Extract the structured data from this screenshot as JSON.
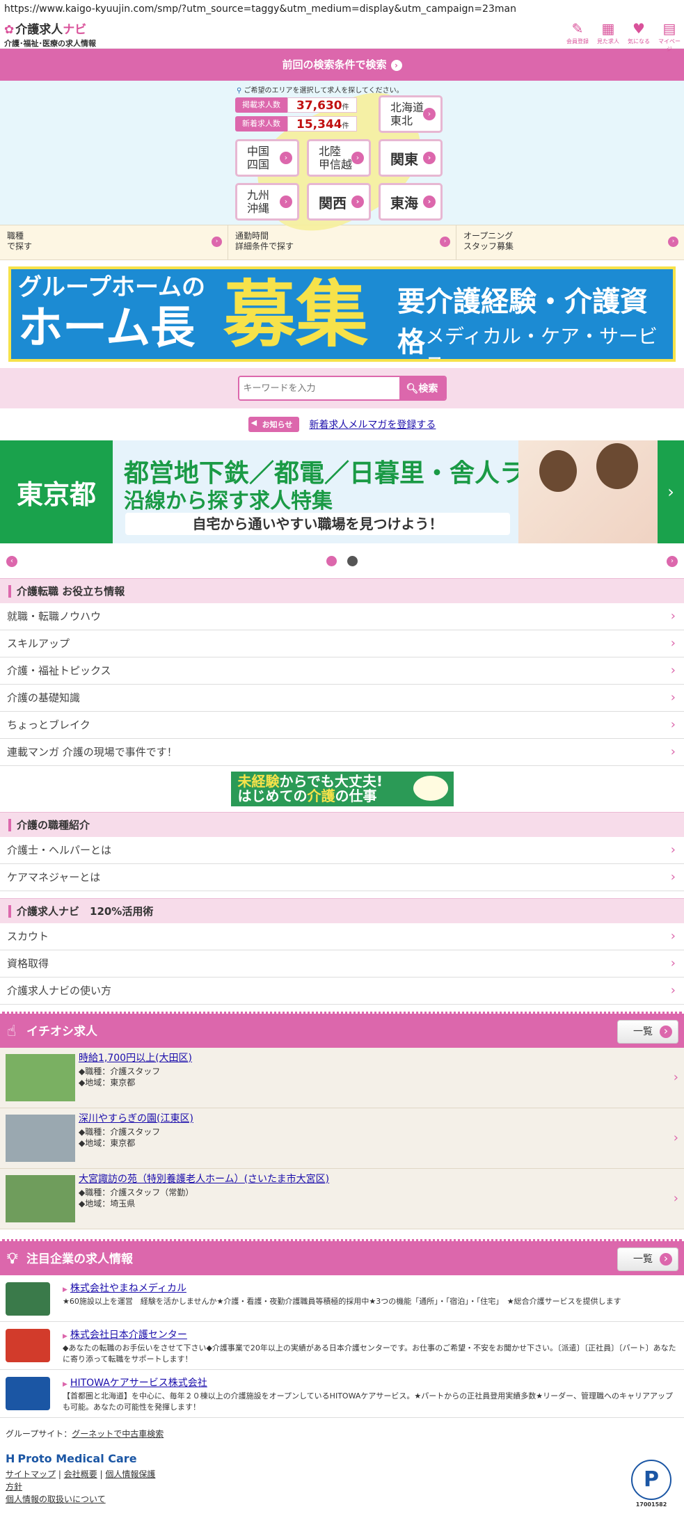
{
  "url": "https://www.kaigo-kyuujin.com/smp/?utm_source=taggy&utm_medium=display&utm_campaign=23man",
  "header": {
    "logo_part1": "介護求人",
    "logo_part2": "ナビ",
    "tagline": "介護･福祉･医療の求人情報",
    "icons": [
      {
        "label": "会員登録",
        "icon": "pencil-icon"
      },
      {
        "label": "見た求人",
        "icon": "calendar-icon"
      },
      {
        "label": "気になる",
        "icon": "heart-icon"
      },
      {
        "label": "マイページ",
        "icon": "book-icon"
      }
    ]
  },
  "prev_search_label": "前回の検索条件で検索",
  "map": {
    "hint": "ご希望のエリアを選択して求人を探してください。",
    "published_label": "掲載求人数",
    "published_count": "37,630",
    "new_label": "新着求人数",
    "new_count": "15,344",
    "unit": "件",
    "regions": [
      "北海道\n東北",
      "中国\n四国",
      "北陸\n甲信越",
      "関東",
      "九州\n沖縄",
      "関西",
      "東海"
    ]
  },
  "categories": [
    {
      "line1": "職種",
      "line2": "で探す"
    },
    {
      "line1": "通勤時間",
      "line2": "詳細条件で探す"
    },
    {
      "line1": "オープニング",
      "line2": "スタッフ募集"
    }
  ],
  "banner1": {
    "line1": "グループホームの",
    "line2": "ホーム長",
    "big": "募集",
    "req": "要介護経験・介護資格",
    "company": "メディカル・ケア・サービス"
  },
  "search": {
    "placeholder": "キーワードを入力",
    "button": "検索"
  },
  "notice": {
    "tag": "お知らせ",
    "link": "新着求人メルマガを登録する"
  },
  "banner2": {
    "pref": "東京都",
    "line1": "都営地下鉄／都電／日暮里・舎人ライナー",
    "line2": "沿線から探す求人特集",
    "line3": "自宅から通いやすい職場を見つけよう！"
  },
  "sections": {
    "tips_title": "介護転職 お役立ち情報",
    "tips": [
      "就職・転職ノウハウ",
      "スキルアップ",
      "介護・福祉トピックス",
      "介護の基礎知識",
      "ちょっとブレイク",
      "連載マンガ 介護の現場で事件です！"
    ],
    "mid_banner_l1a": "未経験",
    "mid_banner_l1b": "からでも大丈夫!",
    "mid_banner_l2a": "はじめての",
    "mid_banner_l2b": "介護",
    "mid_banner_l2c": "の仕事",
    "jobs_title": "介護の職種紹介",
    "jobs": [
      "介護士・ヘルパーとは",
      "ケアマネジャーとは"
    ],
    "use_title": "介護求人ナビ　120%活用術",
    "use": [
      "スカウト",
      "資格取得",
      "介護求人ナビの使い方"
    ]
  },
  "pickup": {
    "title": "イチオシ求人",
    "more": "一覧",
    "items": [
      {
        "title": "時給1,700円以上(大田区)",
        "job": "◆職種：介護スタッフ",
        "area": "◆地域：東京都",
        "imgcolor": "#7ab062"
      },
      {
        "title": "深川やすらぎの園(江東区)",
        "job": "◆職種：介護スタッフ",
        "area": "◆地域：東京都",
        "imgcolor": "#9aa8b0"
      },
      {
        "title": "大宮諏訪の苑（特別養護老人ホーム）(さいたま市大宮区)",
        "job": "◆職種：介護スタッフ（常勤）",
        "area": "◆地域：埼玉県",
        "imgcolor": "#6f9d5c"
      }
    ]
  },
  "companies": {
    "title": "注目企業の求人情報",
    "more": "一覧",
    "items": [
      {
        "name": "株式会社やまねメディカル",
        "desc": "★60施設以上を運営　経験を活かしませんか★介護・看護・夜勤介護職員等積極的採用中★3つの機能「通所」・「宿泊」・「住宅」　★総合介護サービスを提供します",
        "imgcolor": "#3a7a4a"
      },
      {
        "name": "株式会社日本介護センター",
        "desc": "◆あなたの転職のお手伝いをさせて下さい◆介護事業で20年以上の実績がある日本介護センターです。お仕事のご希望・不安をお聞かせ下さい。〔派遣〕〔正社員〕〔パート〕あなたに寄り添って転職をサポートします！",
        "imgcolor": "#d23b2b"
      },
      {
        "name": "HITOWAケアサービス株式会社",
        "desc": "【首都圏と北海道】を中心に、毎年２０棟以上の介護施設をオープンしているHITOWAケアサービス。★パートからの正社員登用実績多数★リーダー、管理職へのキャリアアップも可能。あなたの可能性を発揮します！",
        "imgcolor": "#1b56a4"
      }
    ]
  },
  "footer": {
    "group_label": "グループサイト：",
    "group_link": "グーネットで中古車検索",
    "brand": "Proto Medical Care",
    "links": [
      "サイトマップ",
      "会社概要",
      "個人情報保護"
    ],
    "link_policy": "方針",
    "link_privacy": "個人情報の取扱いについて",
    "pmark_num": "17001582"
  }
}
